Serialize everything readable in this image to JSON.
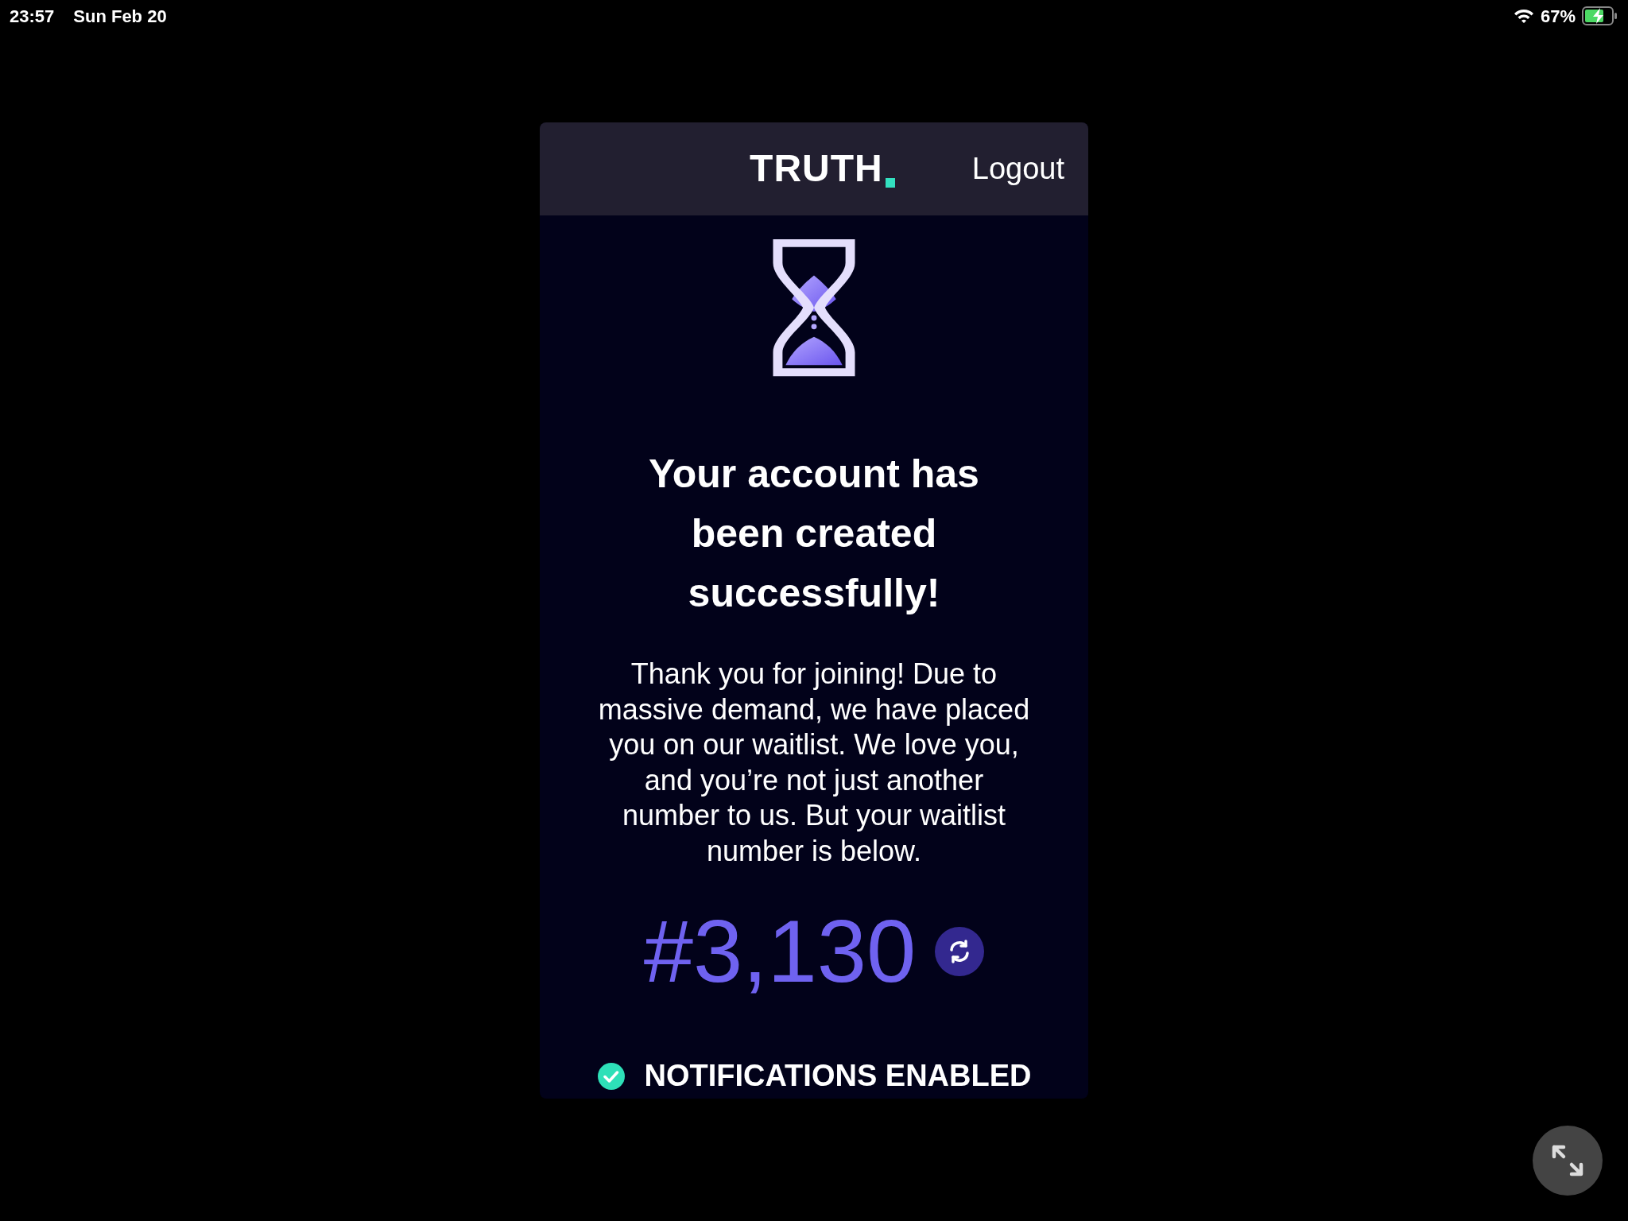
{
  "status_bar": {
    "time": "23:57",
    "date": "Sun Feb 20",
    "battery": "67%"
  },
  "header": {
    "logo": "TRUTH",
    "logout": "Logout"
  },
  "heading": "Your account has been created successfully!",
  "message": "Thank you for joining! Due to massive demand, we have placed you on our waitlist. We love you, and you’re not just another number to us. But your waitlist number is below.",
  "waitlist_number": "#3,130",
  "notifications": {
    "label": "NOTIFICATIONS ENABLED",
    "enabled": true
  }
}
